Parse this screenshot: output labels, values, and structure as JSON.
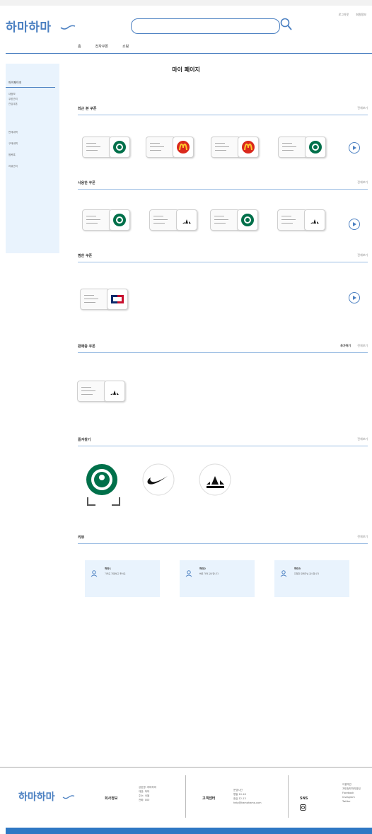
{
  "header": {
    "logo": "하마하마",
    "search": {
      "value": "",
      "placeholder": ""
    },
    "top_links": [
      "로그아웃",
      "회원정보"
    ],
    "nav": [
      "홈",
      "전자쿠폰",
      "쇼핑"
    ]
  },
  "sidebar": {
    "title": "마이페이지",
    "items": [
      "내정보",
      "쿠폰관리",
      "관심쿠폰",
      "판매내역",
      "구매내역",
      "찜목록",
      "리뷰관리"
    ]
  },
  "page_title": "마이 페이지",
  "sections": {
    "recent": {
      "title": "최근 본 쿠폰",
      "more": "전체보기"
    },
    "used": {
      "title": "사용한 쿠폰",
      "more": "전체보기"
    },
    "liked": {
      "title": "찜한 쿠폰",
      "more": "전체보기"
    },
    "selling": {
      "title": "판매중 쿠폰",
      "more": "전체보기",
      "add": "추가하기"
    },
    "brands": {
      "title": "즐겨찾기",
      "more": "전체보기"
    },
    "reviews": {
      "title": "리뷰",
      "more": "전체보기"
    }
  },
  "reviews": [
    {
      "name": "하마1",
      "text": "가격도 저렴하고 좋아요"
    },
    {
      "name": "하마2",
      "text": "빠른 거래 감사합니다"
    },
    {
      "name": "하마3",
      "text": "친절한 판매자님 감사합니다"
    }
  ],
  "footer": {
    "logo": "하마하마",
    "col1_title": "회사정보",
    "col1_lines": [
      "상호명: 하마하마",
      "대표: 하마",
      "주소: 서울",
      "전화: 000"
    ],
    "col2_title": "고객센터",
    "col2_lines": [
      "운영시간",
      "평일 10-18",
      "점심 12-13",
      "help@hamahama.com"
    ],
    "col3_title": "SNS",
    "col3_lines": [
      "이용약관",
      "개인정보처리방침",
      "Facebook",
      "Instagram",
      "Twitter"
    ]
  },
  "colors": {
    "accent": "#4a7fc1",
    "sidebar_bg": "#e9f3fd",
    "bottom_bar": "#2f78c4"
  }
}
